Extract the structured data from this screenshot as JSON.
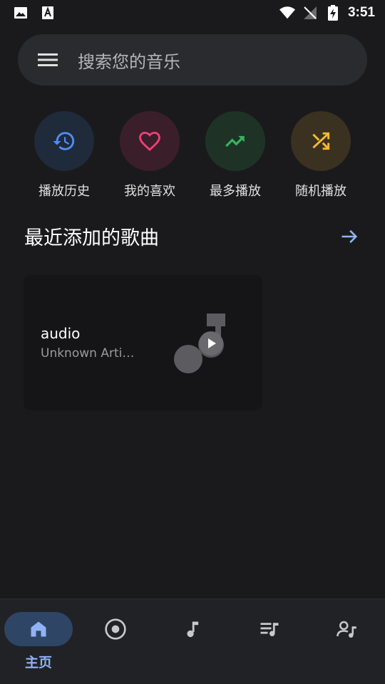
{
  "status_bar": {
    "time": "3:51",
    "left_icons": [
      "image-icon",
      "font-a-icon"
    ],
    "right_icons": [
      "wifi-icon",
      "no-signal-icon",
      "battery-charging-icon"
    ]
  },
  "search": {
    "placeholder": "搜索您的音乐",
    "menu_icon": "hamburger-menu-icon"
  },
  "quick_actions": [
    {
      "label": "播放历史",
      "icon": "history-icon",
      "color": "#4f8ef7",
      "bg": "#1f2a3b"
    },
    {
      "label": "我的喜欢",
      "icon": "heart-icon",
      "color": "#f23f77",
      "bg": "#3a1f2a"
    },
    {
      "label": "最多播放",
      "icon": "trending-up-icon",
      "color": "#36b560",
      "bg": "#1e3326"
    },
    {
      "label": "随机播放",
      "icon": "shuffle-icon",
      "color": "#f5b82e",
      "bg": "#3a3120"
    }
  ],
  "section": {
    "title": "最近添加的歌曲",
    "arrow_icon": "arrow-right-icon",
    "accent": "#8fb4f5"
  },
  "songs": [
    {
      "title": "audio",
      "artist": "Unknown Arti…"
    }
  ],
  "bottom_nav": [
    {
      "label": "主页",
      "icon": "home-icon",
      "active": true
    },
    {
      "label": "",
      "icon": "album-icon",
      "active": false
    },
    {
      "label": "",
      "icon": "music-note-icon",
      "active": false
    },
    {
      "label": "",
      "icon": "playlist-icon",
      "active": false
    },
    {
      "label": "",
      "icon": "artist-icon",
      "active": false
    }
  ]
}
